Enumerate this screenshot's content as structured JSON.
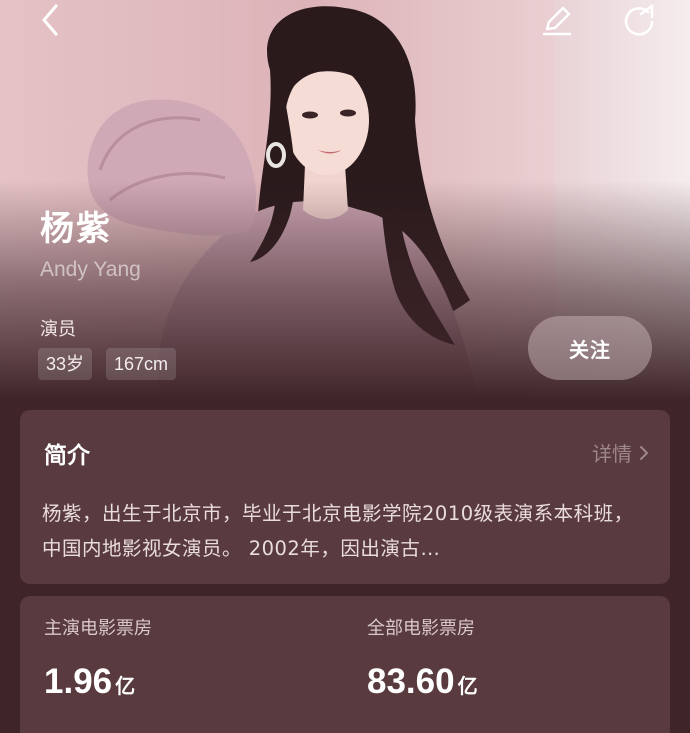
{
  "profile": {
    "name": "杨紫",
    "english_name": "Andy Yang",
    "role": "演员",
    "tags": [
      "33岁",
      "167cm"
    ],
    "follow_label": "关注"
  },
  "toolbar": {
    "back_icon": "chevron-left-icon",
    "edit_icon": "pencil-icon",
    "share_icon": "share-icon"
  },
  "intro": {
    "title": "简介",
    "details_label": "详情",
    "details_icon": "chevron-right-icon",
    "text": "杨紫，出生于北京市，毕业于北京电影学院2010级表演系本科班，中国内地影视女演员。 2002年，因出演古…"
  },
  "box_office": {
    "lead_label": "主演电影票房",
    "lead_value": "1.96",
    "lead_unit": "亿",
    "total_label": "全部电影票房",
    "total_value": "83.60",
    "total_unit": "亿"
  },
  "colors": {
    "background": "#3f2529",
    "card": "#593a3e",
    "follow_button": "#c9b6b8"
  }
}
